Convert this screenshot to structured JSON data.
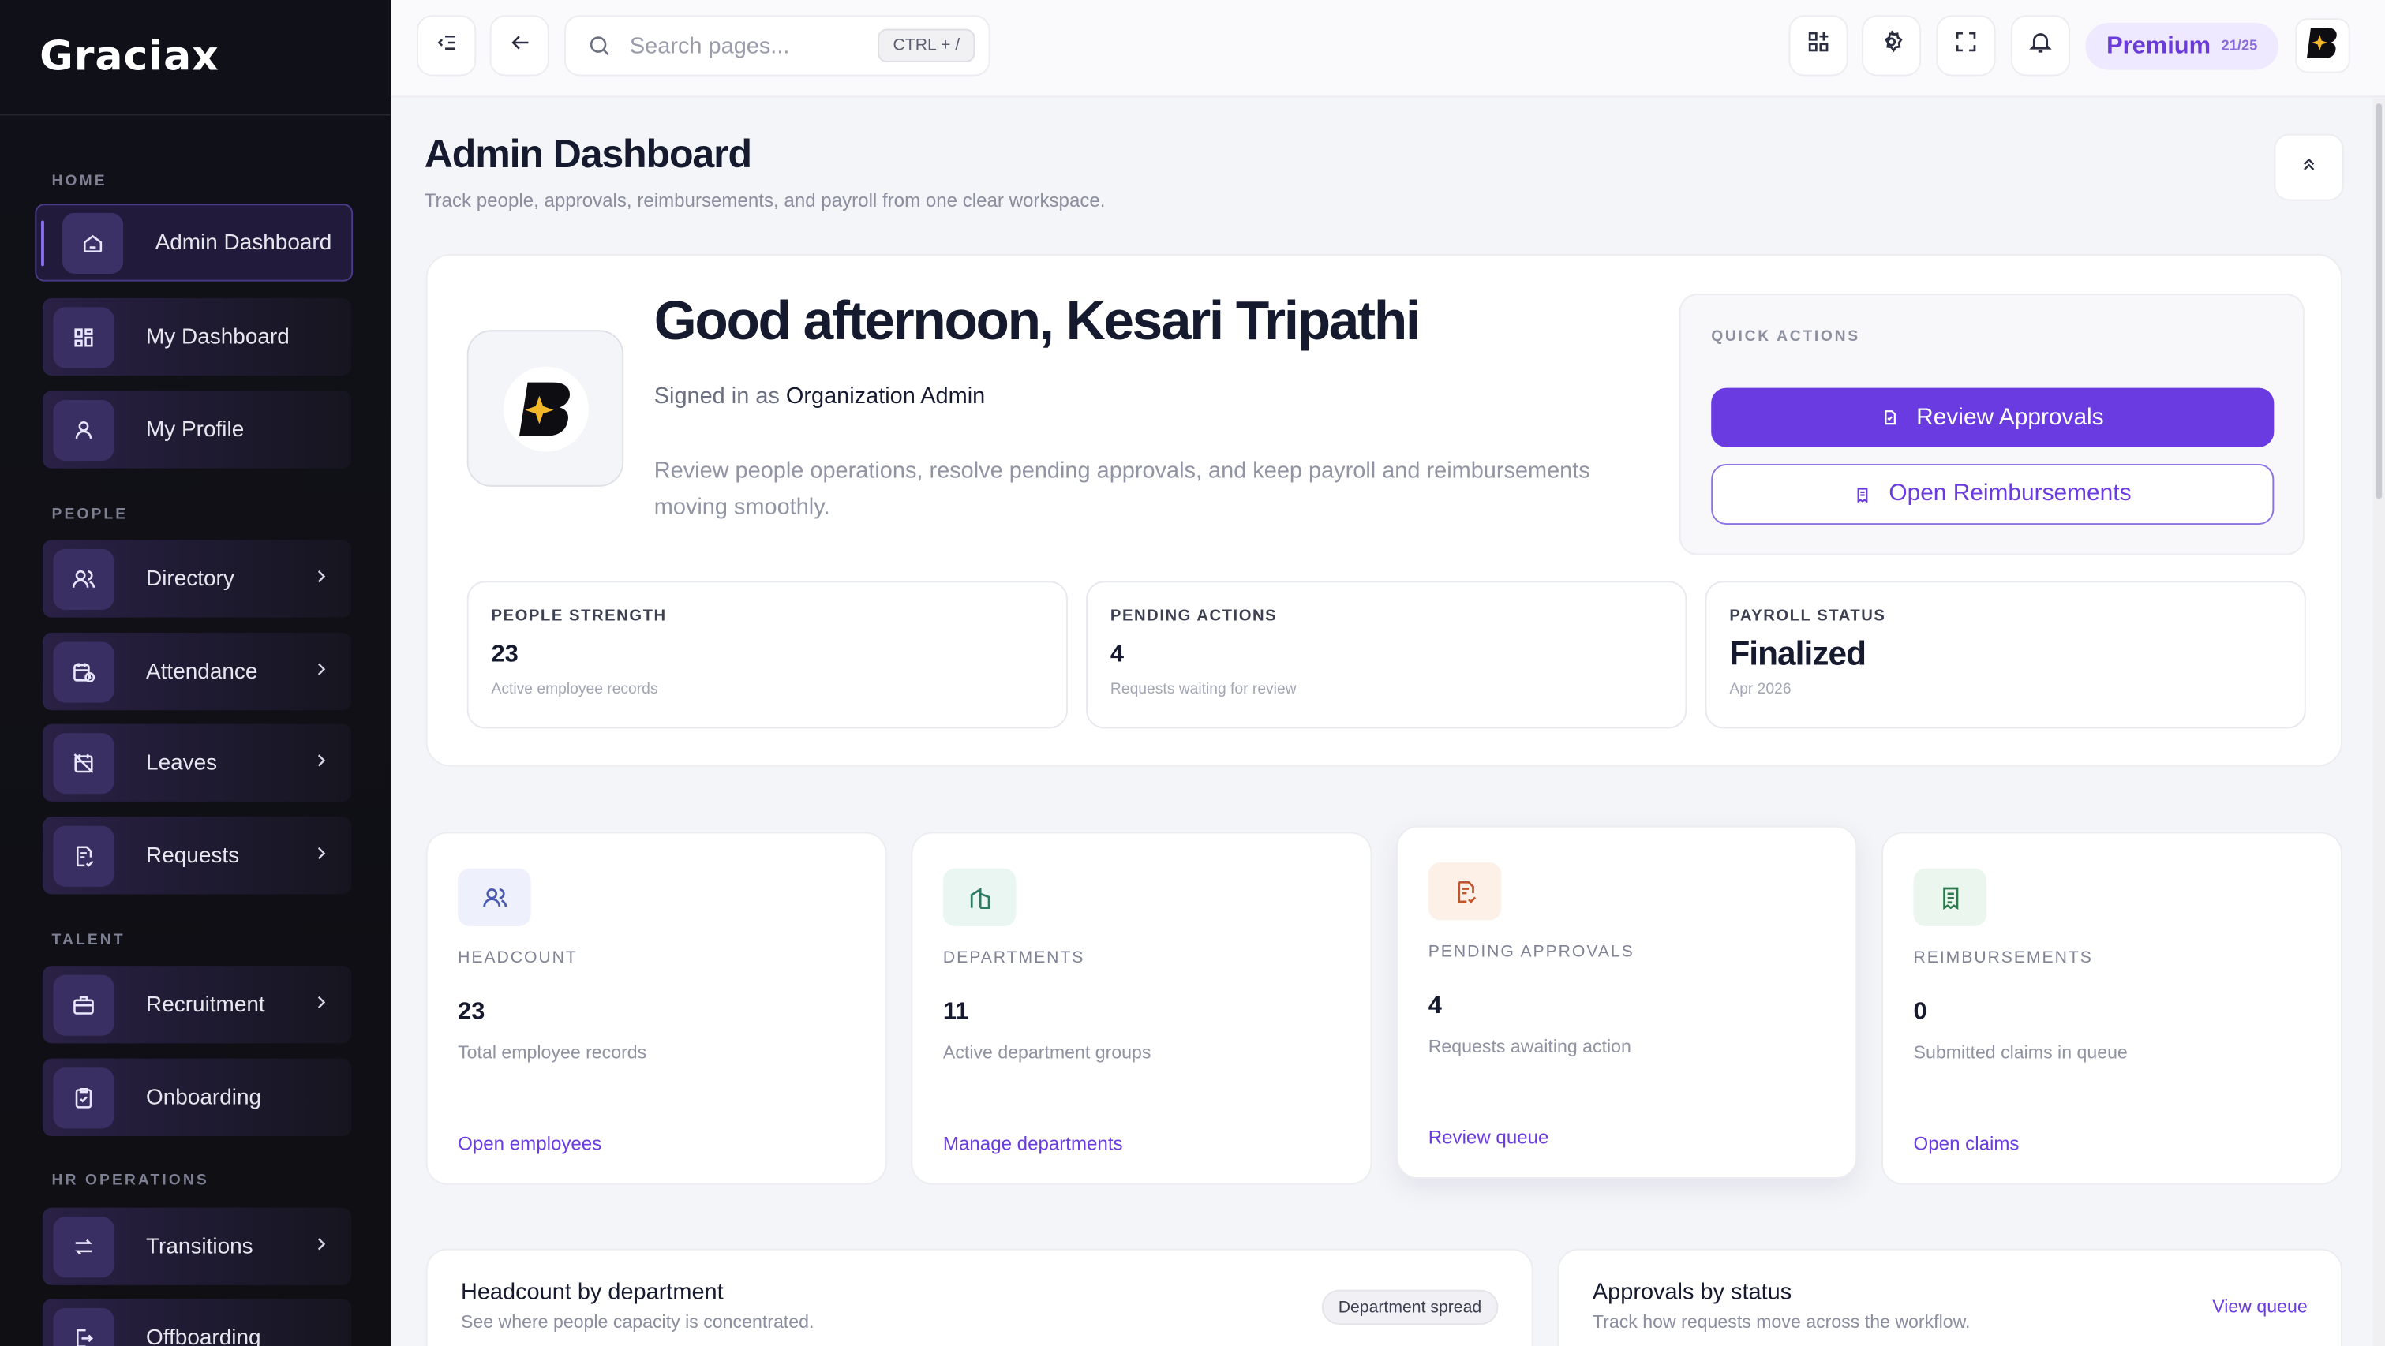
{
  "brand": {
    "name": "Graciax"
  },
  "sidebar": {
    "sections": [
      "HOME",
      "PEOPLE",
      "TALENT",
      "HR OPERATIONS"
    ],
    "items": [
      {
        "label": "Admin Dashboard",
        "icon": "home-icon",
        "active": true
      },
      {
        "label": "My Dashboard",
        "icon": "grid-icon"
      },
      {
        "label": "My Profile",
        "icon": "user-icon"
      },
      {
        "label": "Directory",
        "icon": "users-icon",
        "has_children": true
      },
      {
        "label": "Attendance",
        "icon": "calendar-clock-icon",
        "has_children": true
      },
      {
        "label": "Leaves",
        "icon": "calendar-off-icon",
        "has_children": true
      },
      {
        "label": "Requests",
        "icon": "file-check-icon",
        "has_children": true
      },
      {
        "label": "Recruitment",
        "icon": "briefcase-icon",
        "has_children": true
      },
      {
        "label": "Onboarding",
        "icon": "clipboard-check-icon"
      },
      {
        "label": "Transitions",
        "icon": "arrows-swap-icon",
        "has_children": true
      },
      {
        "label": "Offboarding",
        "icon": "door-exit-icon"
      }
    ]
  },
  "topbar": {
    "search_placeholder": "Search pages...",
    "shortcut": "CTRL + /",
    "premium_label": "Premium",
    "premium_count": "21/25"
  },
  "page": {
    "title": "Admin Dashboard",
    "subtitle": "Track people, approvals, reimbursements, and payroll from one clear workspace."
  },
  "hero": {
    "greeting": "Good afternoon, Kesari Tripathi",
    "signed_prefix": "Signed in as",
    "role": "Organization Admin",
    "description": "Review people operations, resolve pending approvals, and keep payroll and reimbursements moving smoothly.",
    "quick_actions_label": "QUICK ACTIONS",
    "primary_action": "Review Approvals",
    "secondary_action": "Open Reimbursements",
    "stats": [
      {
        "label": "PEOPLE STRENGTH",
        "value": "23",
        "sub": "Active employee records"
      },
      {
        "label": "PENDING ACTIONS",
        "value": "4",
        "sub": "Requests waiting for review"
      },
      {
        "label": "PAYROLL STATUS",
        "value": "Finalized",
        "sub": "Apr 2026"
      }
    ]
  },
  "metrics": [
    {
      "label": "HEADCOUNT",
      "value": "23",
      "sub": "Total employee records",
      "link": "Open employees",
      "icon": "users-icon",
      "icon_bg": "#eef1fb",
      "icon_color": "#4a5bb0"
    },
    {
      "label": "DEPARTMENTS",
      "value": "11",
      "sub": "Active department groups",
      "link": "Manage departments",
      "icon": "building-icon",
      "icon_bg": "#eaf6f2",
      "icon_color": "#2f7a63"
    },
    {
      "label": "PENDING APPROVALS",
      "value": "4",
      "sub": "Requests awaiting action",
      "link": "Review queue",
      "icon": "file-check-icon",
      "icon_bg": "#fdf0e6",
      "icon_color": "#c0542a"
    },
    {
      "label": "REIMBURSEMENTS",
      "value": "0",
      "sub": "Submitted claims in queue",
      "link": "Open claims",
      "icon": "receipt-icon",
      "icon_bg": "#eaf6ee",
      "icon_color": "#2f7a4d"
    }
  ],
  "panels": [
    {
      "title": "Headcount by department",
      "sub": "See where people capacity is concentrated.",
      "badge": "Department spread"
    },
    {
      "title": "Approvals by status",
      "sub": "Track how requests move across the workflow.",
      "link": "View queue"
    }
  ],
  "colors": {
    "accent": "#6a3be0",
    "sidebar_bg": "#101018",
    "page_bg": "#f4f5f8"
  }
}
